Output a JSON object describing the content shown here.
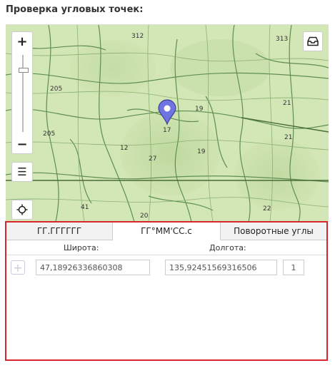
{
  "page": {
    "title": "Проверка угловых точек:"
  },
  "map": {
    "zoom_in_label": "+",
    "zoom_out_label": "−",
    "parcel_labels": [
      "312",
      "313",
      "205",
      "205",
      "19",
      "19",
      "21",
      "21",
      "17",
      "27",
      "41",
      "20",
      "22",
      "12"
    ]
  },
  "tabs": [
    {
      "label": "ГГ.ГГГГГГ"
    },
    {
      "label": "ГГ°ММ'СС.с"
    },
    {
      "label": "Поворотные углы"
    }
  ],
  "coords": {
    "lat_label": "Широта:",
    "lon_label": "Долгота:",
    "lat_value": "47,18926336860308",
    "lon_value": "135,92451569316506",
    "index_value": "1"
  },
  "colors": {
    "highlight": "#d9262e",
    "marker": "#6f74e0",
    "map_bg": "#cfe3b0"
  }
}
